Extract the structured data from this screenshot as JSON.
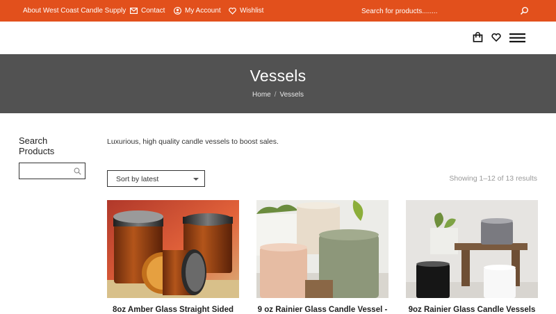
{
  "topbar": {
    "about": "About West Coast Candle Supply",
    "contact": "Contact",
    "account": "My Account",
    "wishlist": "Wishlist",
    "search_placeholder": "Search for products........"
  },
  "header": {
    "icons": [
      "shopping-bag-icon",
      "heart-icon",
      "hamburger-menu-icon"
    ]
  },
  "page": {
    "title": "Vessels",
    "breadcrumb": [
      "Home",
      "Vessels"
    ]
  },
  "sidebar": {
    "title": "Search Products",
    "search_placeholder": ""
  },
  "main": {
    "intro": "Luxurious, high quality candle vessels to boost sales.",
    "sort_selected": "Sort by latest",
    "results": "Showing 1–12 of 13 results",
    "products": [
      {
        "title": "8oz Amber Glass Straight Sided"
      },
      {
        "title": "9 oz Rainier Glass Candle Vessel -"
      },
      {
        "title": "9oz Rainier Glass Candle Vessels"
      }
    ]
  },
  "colors": {
    "topbar": "#e2501c",
    "title_band": "#525252"
  }
}
